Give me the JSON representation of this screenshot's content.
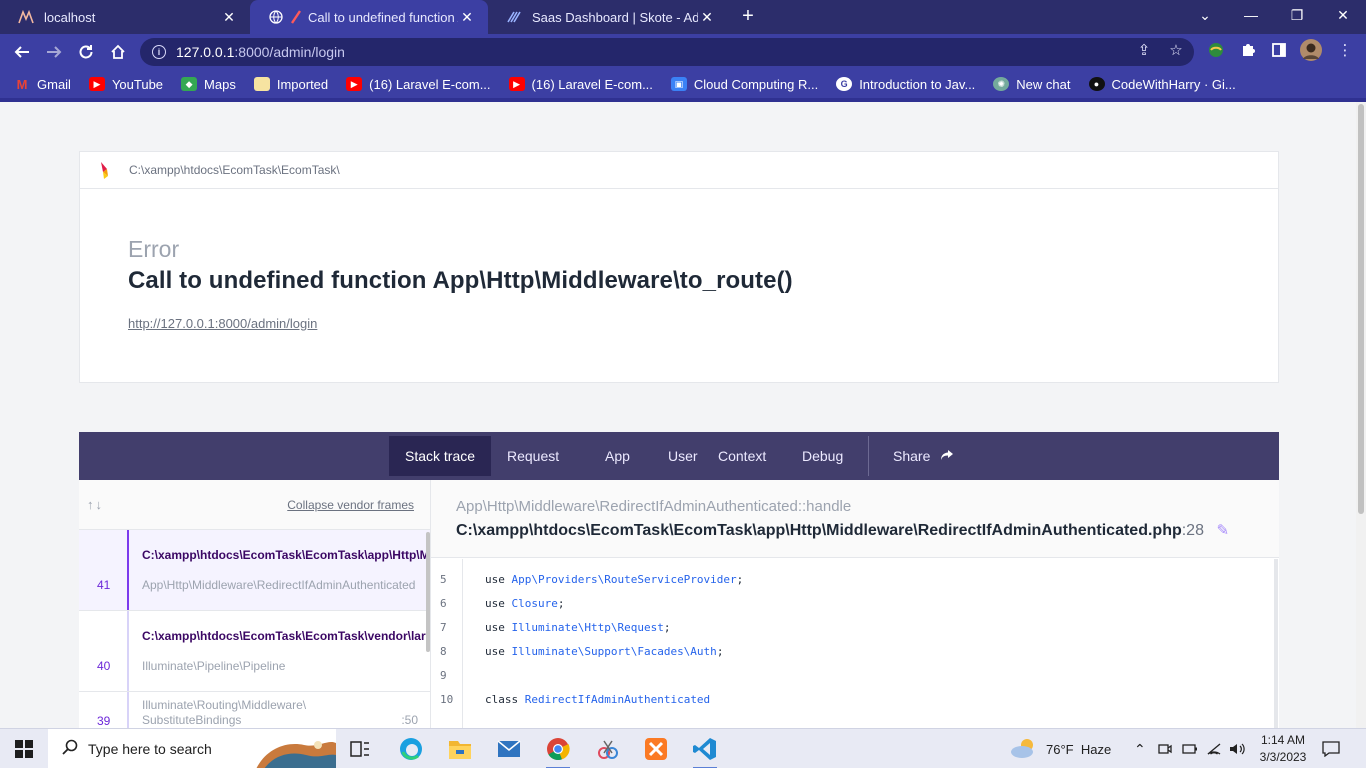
{
  "browser": {
    "tabs": [
      {
        "title": "localhost",
        "icon": "xampp-icon"
      },
      {
        "title": "Call to undefined function App",
        "icon": "globe-icon"
      },
      {
        "title": "Saas Dashboard | Skote - Admin",
        "icon": "skote-icon"
      }
    ],
    "url_host": "127.0.0.1",
    "url_path": ":8000/admin/login",
    "bookmarks": [
      {
        "label": "Gmail",
        "color": "#ea4335"
      },
      {
        "label": "YouTube",
        "color": "#ff0000"
      },
      {
        "label": "Maps",
        "color": "#34a853"
      },
      {
        "label": "Imported",
        "color": "#f6c84c"
      },
      {
        "label": "(16) Laravel E-com...",
        "color": "#ff0000"
      },
      {
        "label": "(16) Laravel E-com...",
        "color": "#ff0000"
      },
      {
        "label": "Cloud Computing R...",
        "color": "#3b82f6"
      },
      {
        "label": "Introduction to Jav...",
        "color": "#ffffff"
      },
      {
        "label": "New chat",
        "color": "#74aa9c"
      },
      {
        "label": "CodeWithHarry · Gi...",
        "color": "#111111"
      }
    ]
  },
  "ignition": {
    "project_path": "C:\\xampp\\htdocs\\EcomTask\\EcomTask\\",
    "error_label": "Error",
    "error_message": "Call to undefined function App\\Http\\Middleware\\to_route()",
    "request_url": "http://127.0.0.1:8000/admin/login",
    "tabs": [
      "Stack trace",
      "Request",
      "App",
      "User",
      "Context",
      "Debug"
    ],
    "share_label": "Share",
    "collapse_label": "Collapse vendor frames",
    "frames": [
      {
        "number": "41",
        "path": "C:\\xampp\\htdocs\\EcomTask\\EcomTask\\app\\Http\\Middleware\\RedirectIfAdminAuthenticated.php",
        "class": "App\\Http\\Middleware\\RedirectIfAdminAuthenticated"
      },
      {
        "number": "40",
        "path": "C:\\xampp\\htdocs\\EcomTask\\EcomTask\\vendor\\laravel\\framework",
        "class": "Illuminate\\Pipeline\\Pipeline"
      },
      {
        "number": "39",
        "class_line1": "Illuminate\\Routing\\Middleware\\",
        "class_line2": "SubstituteBindings",
        "line": ":50"
      }
    ],
    "code_class": "App\\Http\\Middleware\\RedirectIfAdminAuthenticated::handle",
    "code_file": "C:\\xampp\\htdocs\\EcomTask\\EcomTask\\app\\Http\\Middleware\\RedirectIfAdminAuthenticated.php",
    "code_line": ":28",
    "code_lines": [
      {
        "n": "5",
        "kw": "use ",
        "rest": "App\\Providers\\RouteServiceProvider",
        "end": ";"
      },
      {
        "n": "6",
        "kw": "use ",
        "rest": "Closure",
        "end": ";"
      },
      {
        "n": "7",
        "kw": "use ",
        "rest": "Illuminate\\Http\\Request",
        "end": ";"
      },
      {
        "n": "8",
        "kw": "use ",
        "rest": "Illuminate\\Support\\Facades\\Auth",
        "end": ";"
      },
      {
        "n": "9",
        "kw": "",
        "rest": "",
        "end": ""
      },
      {
        "n": "10",
        "kw": "class ",
        "rest": "RedirectIfAdminAuthenticated",
        "end": ""
      }
    ]
  },
  "taskbar": {
    "search_placeholder": "Type here to search",
    "weather": "76°F  Haze",
    "time": "1:14 AM",
    "date": "3/3/2023"
  }
}
